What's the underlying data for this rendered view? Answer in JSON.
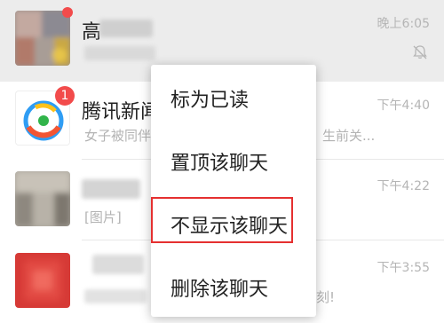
{
  "chats": [
    {
      "name": "高",
      "time": "晚上6:05",
      "muted": true,
      "unread_dot": true,
      "preview": ""
    },
    {
      "name": "腾讯新闻",
      "time": "下午4:40",
      "badge": "1",
      "preview_left": "女子被同伴",
      "preview_right": "生前关..."
    },
    {
      "name": "",
      "time": "下午4:22",
      "preview": "[图片]"
    },
    {
      "name": "",
      "time": "下午3:55",
      "preview_right": "刻!"
    }
  ],
  "context_menu": {
    "items": [
      {
        "label": "标为已读"
      },
      {
        "label": "置顶该聊天"
      },
      {
        "label": "不显示该聊天"
      },
      {
        "label": "删除该聊天"
      }
    ],
    "highlighted_item": "不显示该聊天"
  },
  "colors": {
    "badge": "#f24b4b",
    "highlight_box": "#e53030",
    "pressed_row": "#ececec"
  }
}
